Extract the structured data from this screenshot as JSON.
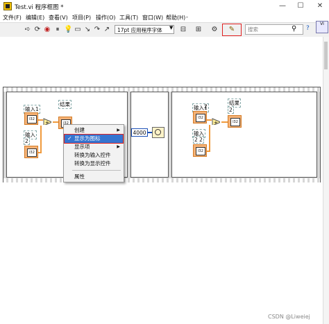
{
  "window": {
    "title": "Test.vi 程序框图 *",
    "minimize": "—",
    "maximize": "☐",
    "close": "✕"
  },
  "menu": {
    "items": [
      "文件(F)",
      "编辑(E)",
      "查看(V)",
      "项目(P)",
      "操作(O)",
      "工具(T)",
      "窗口(W)",
      "帮助(H)"
    ],
    "extra": "-"
  },
  "toolbar": {
    "font_select": "17pt 应用程序字体",
    "search_placeholder": "搜索",
    "help": "?"
  },
  "diagram": {
    "frame1": {
      "input1_label": "输入1",
      "input2_label": "输入",
      "input2_value": "2",
      "result_label": "结果",
      "ctrl_text": "I32"
    },
    "frame2": {
      "wait_value": "4000"
    },
    "frame3": {
      "input1_label": "输入1",
      "input1_value": "2",
      "input2_label": "输入",
      "input2_value": "2 2",
      "result_label": "结果",
      "result_value": "2",
      "ctrl_text": "I32"
    }
  },
  "context_menu": {
    "items": [
      {
        "label": "创建",
        "submenu": true
      },
      {
        "label": "显示为图标",
        "checked": true,
        "selected": true
      },
      {
        "label": "显示项",
        "submenu": true
      },
      {
        "label": "转换为输入控件"
      },
      {
        "label": "转换为显示控件"
      },
      {
        "label": "属性"
      }
    ],
    "check_mark": "✓",
    "arrow": "▶"
  },
  "watermark": "CSDN @Liweiej"
}
